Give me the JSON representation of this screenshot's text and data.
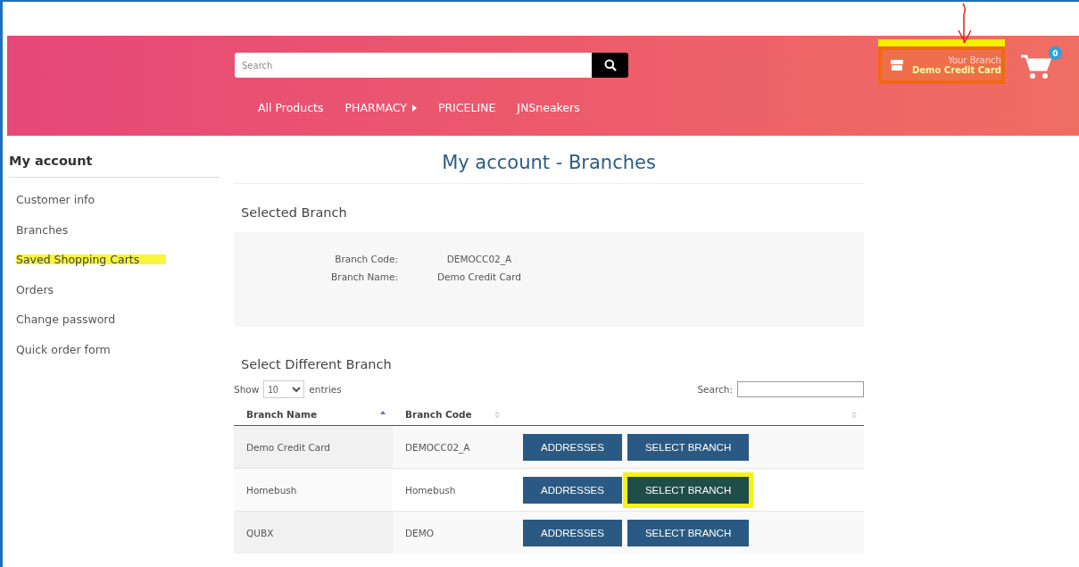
{
  "header": {
    "search": {
      "placeholder": "Search"
    },
    "nav": [
      {
        "label": "All Products",
        "has_submenu": false
      },
      {
        "label": "PHARMACY",
        "has_submenu": true
      },
      {
        "label": "PRICELINE",
        "has_submenu": false
      },
      {
        "label": "JNSneakers",
        "has_submenu": false
      }
    ],
    "branch": {
      "caption": "Your Branch",
      "name": "Demo Credit Card",
      "highlighted": true
    },
    "cart": {
      "count": "0"
    }
  },
  "sidebar": {
    "title": "My account",
    "items": [
      {
        "label": "Customer info",
        "highlighted": false
      },
      {
        "label": "Branches",
        "highlighted": false
      },
      {
        "label": "Saved Shopping Carts",
        "highlighted": true
      },
      {
        "label": "Orders",
        "highlighted": false
      },
      {
        "label": "Change password",
        "highlighted": false
      },
      {
        "label": "Quick order form",
        "highlighted": false
      }
    ]
  },
  "page_title": "My account - Branches",
  "selected_branch": {
    "heading": "Selected Branch",
    "fields": [
      {
        "label": "Branch Code:",
        "value": "DEMOCC02_A"
      },
      {
        "label": "Branch Name:",
        "value": "Demo Credit Card"
      }
    ]
  },
  "select_different": {
    "heading": "Select Different Branch",
    "show_label": "Show",
    "page_size": "10",
    "entries_label": "entries",
    "search_label": "Search:",
    "columns": [
      {
        "label": "Branch Name",
        "sorted": true
      },
      {
        "label": "Branch Code",
        "sorted": false
      },
      {
        "sorted": false
      }
    ],
    "rows": [
      {
        "name": "Demo Credit Card",
        "code": "DEMOCC02_A",
        "buttons": [
          {
            "label": "ADDRESSES",
            "highlighted": false
          },
          {
            "label": "SELECT BRANCH",
            "highlighted": false
          }
        ]
      },
      {
        "name": "Homebush",
        "code": "Homebush",
        "buttons": [
          {
            "label": "ADDRESSES",
            "highlighted": false
          },
          {
            "label": "SELECT BRANCH",
            "highlighted": true
          }
        ]
      },
      {
        "name": "QUBX",
        "code": "DEMO",
        "buttons": [
          {
            "label": "ADDRESSES",
            "highlighted": false
          },
          {
            "label": "SELECT BRANCH",
            "highlighted": false
          }
        ]
      }
    ]
  }
}
